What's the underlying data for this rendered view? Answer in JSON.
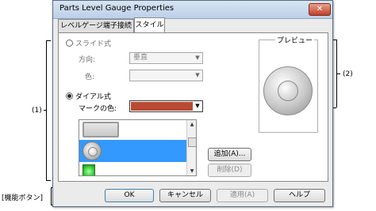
{
  "dialog": {
    "title": "Parts Level Gauge Properties",
    "close_glyph": "✕",
    "tabs": [
      {
        "label": "レベルゲージ端子接続"
      },
      {
        "label": "スタイル"
      }
    ]
  },
  "style_panel": {
    "slide_option": {
      "label": "スライド式",
      "selected": false
    },
    "direction_label": "方向:",
    "direction_value": "垂直",
    "color_label": "色:",
    "color_value": "",
    "dial_option": {
      "label": "ダイアル式",
      "selected": true
    },
    "mark_color_label": "マークの色:",
    "mark_color_value": "#b94a34",
    "preview_label": "プレビュー",
    "add_button": "追加(A)...",
    "delete_button": "削除(D)"
  },
  "footer": {
    "ok": "OK",
    "cancel": "キャンセル",
    "apply": "適用(A)",
    "help": "ヘルプ"
  },
  "annotations": {
    "one": "(1)",
    "two": "(2)",
    "func_buttons": "[機能ボタン]"
  },
  "colors": {
    "selected_row": "#3399ff",
    "gauge_green": "#33cc33"
  },
  "icons": [
    "close-icon",
    "dropdown-arrow-icon",
    "dial-gauge-icon",
    "scroll-up-icon",
    "scroll-down-icon"
  ]
}
